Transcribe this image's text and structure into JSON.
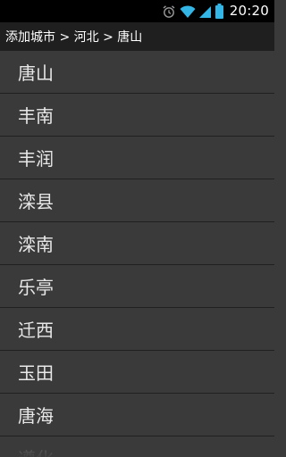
{
  "status_bar": {
    "time": "20:20",
    "icons": [
      "alarm-icon",
      "wifi-icon",
      "signal-icon",
      "battery-icon"
    ],
    "accent_color": "#33b5e5"
  },
  "header": {
    "title": "添加城市",
    "separator": " > ",
    "breadcrumb": [
      "河北",
      "唐山"
    ]
  },
  "cities": [
    "唐山",
    "丰南",
    "丰润",
    "滦县",
    "滦南",
    "乐亭",
    "迁西",
    "玉田",
    "唐海",
    "遵化"
  ]
}
